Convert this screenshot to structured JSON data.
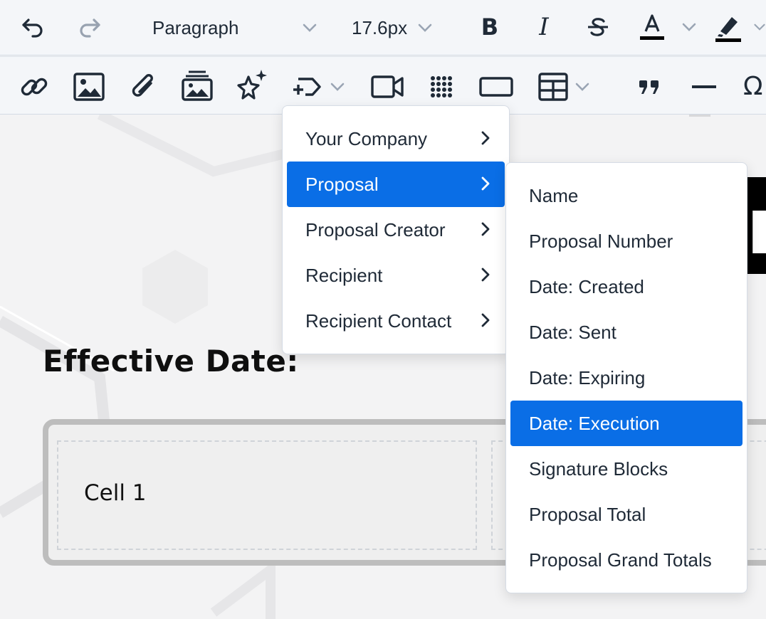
{
  "toolbar": {
    "row1": {
      "undo_icon": "undo-icon",
      "redo_icon": "redo-icon",
      "block_style": "Paragraph",
      "font_size": "17.6px",
      "bold_icon": "bold-icon",
      "italic_icon": "italic-icon",
      "strikethrough_icon": "strikethrough-icon",
      "text_color_icon": "text-color-icon",
      "highlight_icon": "highlight-icon"
    },
    "row2": {
      "icons": [
        "link-icon",
        "image-icon",
        "attachment-icon",
        "gallery-icon",
        "sparkle-icon",
        "insert-variable-icon",
        "video-icon",
        "grid-icon",
        "button-icon",
        "table-icon",
        "quote-icon",
        "horizontal-rule-icon",
        "special-character-icon"
      ]
    }
  },
  "document": {
    "effective_date_label": "Effective Date:",
    "table": {
      "cell_1": "Cell 1"
    }
  },
  "menus": {
    "main": [
      {
        "label": "Your Company",
        "active": false
      },
      {
        "label": "Proposal",
        "active": true
      },
      {
        "label": "Proposal Creator",
        "active": false
      },
      {
        "label": "Recipient",
        "active": false
      },
      {
        "label": "Recipient Contact",
        "active": false
      }
    ],
    "sub": [
      {
        "label": "Name",
        "active": false
      },
      {
        "label": "Proposal Number",
        "active": false
      },
      {
        "label": "Date: Created",
        "active": false
      },
      {
        "label": "Date: Sent",
        "active": false
      },
      {
        "label": "Date: Expiring",
        "active": false
      },
      {
        "label": "Date: Execution",
        "active": true
      },
      {
        "label": "Signature Blocks",
        "active": false
      },
      {
        "label": "Proposal Total",
        "active": false
      },
      {
        "label": "Proposal Grand Totals",
        "active": false
      }
    ]
  },
  "colors": {
    "accent": "#0a6ee6",
    "toolbar_bg": "#f4f6f9",
    "canvas_bg": "#f3f3f4"
  }
}
